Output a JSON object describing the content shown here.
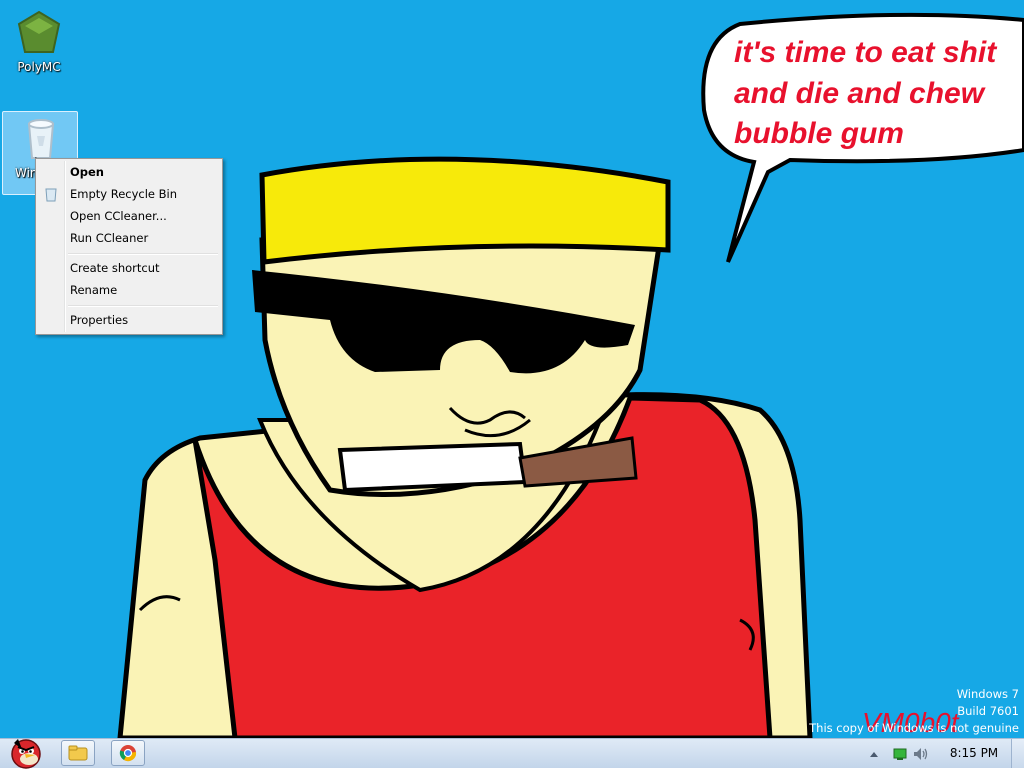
{
  "desktop": {
    "icons": [
      {
        "label": "PolyMC",
        "icon": "polymc-icon"
      },
      {
        "label": "Windows Vi",
        "icon": "recycle-bin-icon"
      }
    ],
    "wallpaper_caption_lines": [
      "it's time to eat shit",
      "and die and chew",
      "bubble gum"
    ],
    "signature": "VM0b0t"
  },
  "context_menu": {
    "items": [
      {
        "label": "Open",
        "bold": true
      },
      {
        "label": "Empty Recycle Bin",
        "icon": "recycle-bin-icon"
      },
      {
        "label": "Open CCleaner..."
      },
      {
        "label": "Run CCleaner"
      },
      {
        "label": "Create shortcut"
      },
      {
        "label": "Rename"
      },
      {
        "label": "Properties"
      }
    ]
  },
  "watermark": {
    "line1": "Windows 7",
    "line2": "Build 7601",
    "line3": "This copy of Windows is not genuine"
  },
  "taskbar": {
    "start_icon": "angry-bird-icon",
    "pinned": [
      "file-explorer-icon",
      "chrome-icon"
    ],
    "tray_icons": [
      "show-hidden-icons-arrow",
      "network-icon",
      "volume-icon"
    ],
    "clock": "8:15 PM"
  },
  "colors": {
    "desktop_bg": "#16a8e6",
    "caption_text": "#e8112d",
    "hat": "#f7ea0a",
    "skin": "#faf3b6",
    "shirt": "#ea2329",
    "cigar": "#8b5a44"
  }
}
